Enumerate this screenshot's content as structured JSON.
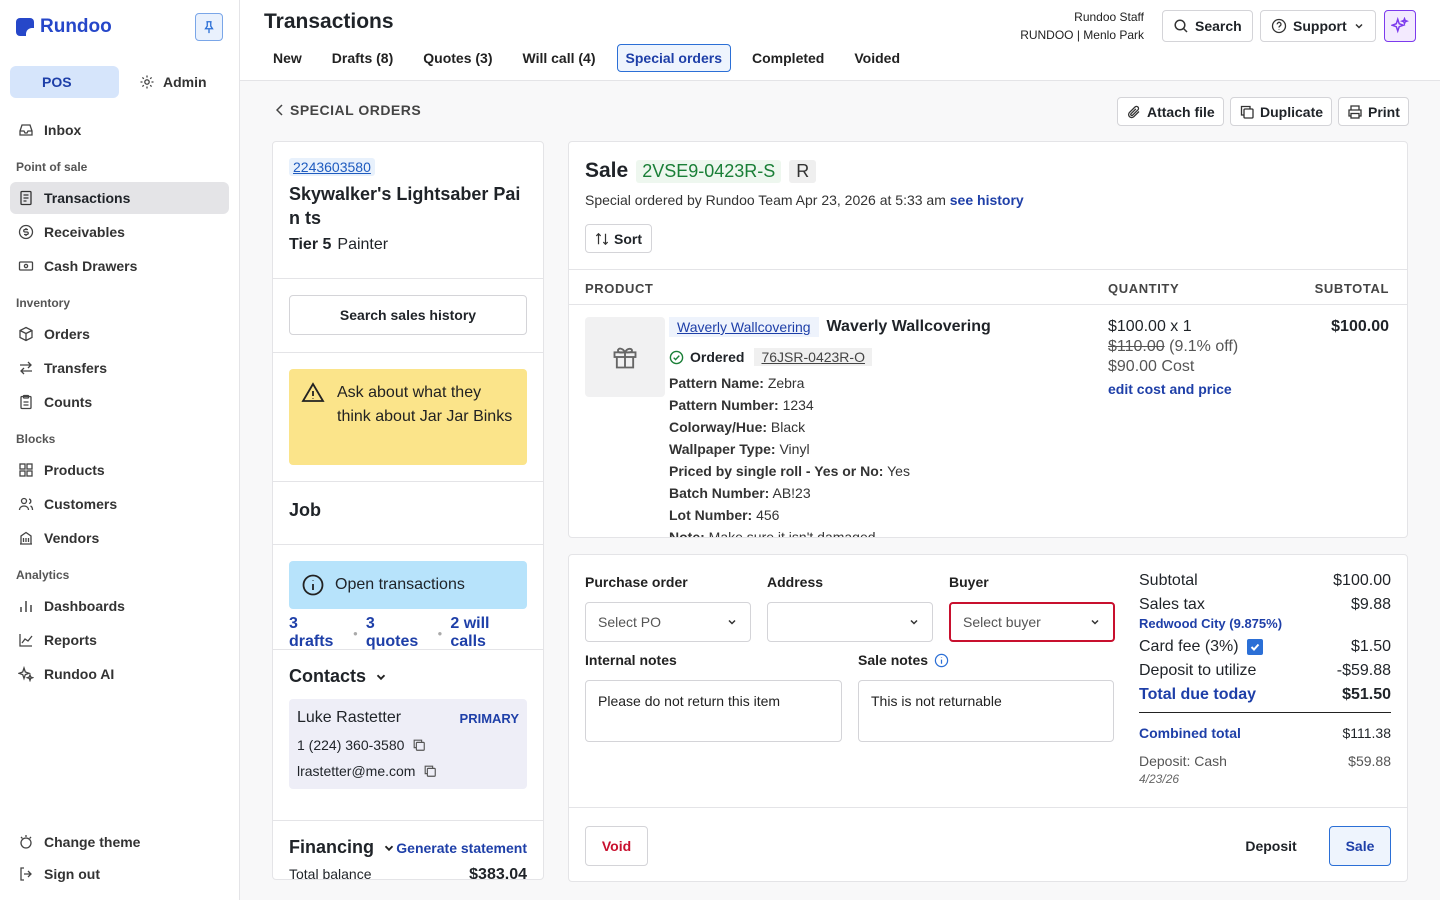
{
  "app": {
    "logo": "Rundoo"
  },
  "sidebar": {
    "modes": [
      {
        "label": "POS"
      },
      {
        "label": "Admin"
      }
    ],
    "sections": {
      "pos": "Point of sale",
      "inventory": "Inventory",
      "blocks": "Blocks",
      "analytics": "Analytics"
    },
    "items": [
      {
        "label": "Inbox",
        "icon": "inbox-icon"
      },
      {
        "label": "Transactions",
        "icon": "receipt-icon"
      },
      {
        "label": "Receivables",
        "icon": "dollar-icon"
      },
      {
        "label": "Cash Drawers",
        "icon": "cash-icon"
      },
      {
        "label": "Orders",
        "icon": "box-icon"
      },
      {
        "label": "Transfers",
        "icon": "transfer-icon"
      },
      {
        "label": "Counts",
        "icon": "clipboard-icon"
      },
      {
        "label": "Products",
        "icon": "grid-icon"
      },
      {
        "label": "Customers",
        "icon": "users-icon"
      },
      {
        "label": "Vendors",
        "icon": "building-icon"
      },
      {
        "label": "Dashboards",
        "icon": "bar-chart-icon"
      },
      {
        "label": "Reports",
        "icon": "line-chart-icon"
      },
      {
        "label": "Rundoo AI",
        "icon": "sparkle-icon"
      },
      {
        "label": "Change theme",
        "icon": "theme-icon"
      },
      {
        "label": "Sign out",
        "icon": "sign-out-icon"
      }
    ]
  },
  "header": {
    "title": "Transactions",
    "tabs": [
      {
        "label": "New"
      },
      {
        "label": "Drafts (8)"
      },
      {
        "label": "Quotes (3)"
      },
      {
        "label": "Will call (4)"
      },
      {
        "label": "Special orders"
      },
      {
        "label": "Completed"
      },
      {
        "label": "Voided"
      }
    ],
    "staff_name": "Rundoo Staff",
    "store": "RUNDOO | Menlo Park",
    "search_label": "Search",
    "support_label": "Support"
  },
  "toolbar": {
    "back_label": "SPECIAL ORDERS",
    "attach": "Attach file",
    "duplicate": "Duplicate",
    "print": "Print"
  },
  "customer": {
    "id": "2243603580",
    "name": "Skywalker's Lightsaber Pain ts",
    "tier": "Tier 5",
    "type": "Painter",
    "search_history": "Search sales history",
    "alert": "Ask about what they think about Jar Jar Binks",
    "job_label": "Job",
    "open_tx": "Open transactions",
    "drafts": "3 drafts",
    "quotes": "3 quotes",
    "will_calls": "2 will calls",
    "contacts_label": "Contacts",
    "contact": {
      "name": "Luke Rastetter",
      "tag": "PRIMARY",
      "phone": "1 (224) 360-3580",
      "email": "lrastetter@me.com"
    },
    "financing_label": "Financing",
    "generate": "Generate statement",
    "total_balance_label": "Total balance",
    "total_balance": "$383.04"
  },
  "sale": {
    "label": "Sale",
    "number": "2VSE9-0423R-S",
    "flag": "R",
    "meta": "Special ordered by Rundoo Team Apr 23, 2026 at 5:33 am",
    "history_link": "see history",
    "sort": "Sort",
    "cols": {
      "product": "PRODUCT",
      "quantity": "QUANTITY",
      "subtotal": "SUBTOTAL"
    },
    "item": {
      "vendor": "Waverly Wallcovering",
      "name": "Waverly Wallcovering",
      "status": "Ordered",
      "order_ref": "76JSR-0423R-O",
      "attrs": [
        {
          "k": "Pattern Name:",
          "v": "Zebra"
        },
        {
          "k": "Pattern Number:",
          "v": "1234"
        },
        {
          "k": "Colorway/Hue:",
          "v": "Black"
        },
        {
          "k": "Wallpaper Type:",
          "v": "Vinyl"
        },
        {
          "k": "Priced by single roll - Yes or No:",
          "v": "Yes"
        },
        {
          "k": "Batch Number:",
          "v": "AB!23"
        },
        {
          "k": "Lot Number:",
          "v": "456"
        },
        {
          "k": "Note:",
          "v": "Make sure it isn't damaged"
        }
      ],
      "price_qty": "$100.00 x 1",
      "orig_price": "$110.00",
      "discount": "(9.1% off)",
      "cost": "$90.00 Cost",
      "edit": "edit cost and price",
      "subtotal": "$100.00"
    }
  },
  "form": {
    "po_label": "Purchase order",
    "po_placeholder": "Select PO",
    "address_label": "Address",
    "buyer_label": "Buyer",
    "buyer_placeholder": "Select buyer",
    "internal_label": "Internal notes",
    "internal_value": "Please do not return this item",
    "sale_notes_label": "Sale notes",
    "sale_notes_value": "This is not returnable"
  },
  "summary": {
    "subtotal_label": "Subtotal",
    "subtotal": "$100.00",
    "tax_label": "Sales tax",
    "tax": "$9.88",
    "tax_region": "Redwood City (9.875%)",
    "card_fee_label": "Card fee (3%)",
    "card_fee": "$1.50",
    "deposit_util_label": "Deposit to utilize",
    "deposit_util": "-$59.88",
    "due_label": "Total due today",
    "due": "$51.50",
    "combined_label": "Combined total",
    "combined": "$111.38",
    "deposit_label": "Deposit: Cash",
    "deposit": "$59.88",
    "deposit_date": "4/23/26"
  },
  "actions": {
    "void": "Void",
    "deposit": "Deposit",
    "sale": "Sale"
  },
  "colors": {
    "accent": "#1e3fa8",
    "sale_number": "#1a7f37",
    "void": "#c8102e",
    "alert": "#fbe48a",
    "info": "#b7e3fb",
    "ai": "#7c3aed"
  }
}
